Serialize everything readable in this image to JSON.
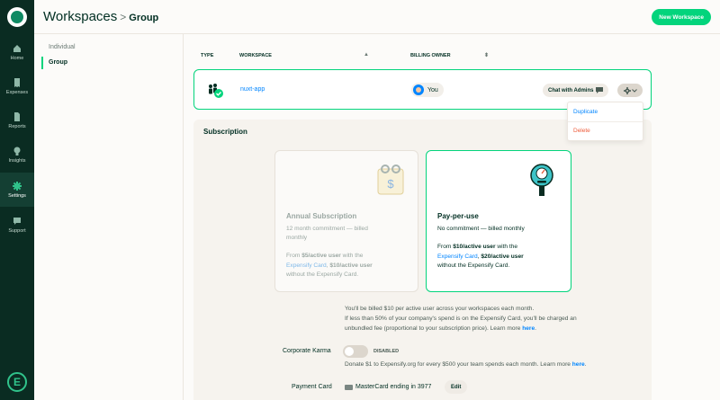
{
  "nav": {
    "items": [
      {
        "label": "Home",
        "icon": "home-icon"
      },
      {
        "label": "Expenses",
        "icon": "receipt-icon"
      },
      {
        "label": "Reports",
        "icon": "document-icon"
      },
      {
        "label": "Insights",
        "icon": "lightbulb-icon"
      },
      {
        "label": "Settings",
        "icon": "gear-icon",
        "active": true
      },
      {
        "label": "Support",
        "icon": "chat-bubble-icon"
      }
    ],
    "brand_letter": "E"
  },
  "header": {
    "title": "Workspaces",
    "separator": ">",
    "subtitle": "Group",
    "new_button": "New Workspace"
  },
  "subnav": {
    "items": [
      {
        "label": "Individual",
        "active": false
      },
      {
        "label": "Group",
        "active": true
      }
    ]
  },
  "table": {
    "col_type": "TYPE",
    "col_workspace": "WORKSPACE",
    "col_owner": "BILLING OWNER",
    "sort_up": "▲",
    "sort_both": "⬍",
    "row": {
      "workspace": "nuxt-app",
      "owner": "You",
      "chat_button": "Chat with Admins"
    }
  },
  "menu": {
    "duplicate": "Duplicate",
    "delete": "Delete"
  },
  "subscription": {
    "title": "Subscription",
    "annual": {
      "title": "Annual Subscription",
      "line1": "12 month commitment — billed",
      "line2": "monthly",
      "from": "From ",
      "price1": "$5/active user",
      "with": " with the",
      "card_link": "Expensify Card",
      "comma": ", ",
      "price2": "$10/active user",
      "without": "without the Expensify Card."
    },
    "ppu": {
      "title": "Pay-per-use",
      "line1": "No commitment — billed monthly",
      "from": "From ",
      "price1": "$10/active user",
      "with": " with the",
      "card_link": "Expensify Card",
      "comma": ", ",
      "price2": "$20/active user",
      "without": "without the Expensify Card."
    },
    "note1": "You'll be billed $10 per active user across your workspaces each month.",
    "note2": "If less than 50% of your company's spend is on the Expensify Card, you'll be charged an",
    "note3": "unbundled fee (proportional to your subscription price). Learn more ",
    "here": "here",
    "dot": "."
  },
  "karma": {
    "label": "Corporate Karma",
    "state": "DISABLED",
    "enabled": false,
    "note": "Donate $1 to Expensify.org for every $500 your team spends each month. Learn more ",
    "here": "here",
    "dot": "."
  },
  "payment": {
    "label": "Payment Card",
    "card": "MasterCard ending in 3977",
    "edit": "Edit"
  },
  "colors": {
    "accent": "#03d47c",
    "link": "#0185ff",
    "danger": "#ee5c3b",
    "rail": "#0a2c22"
  }
}
